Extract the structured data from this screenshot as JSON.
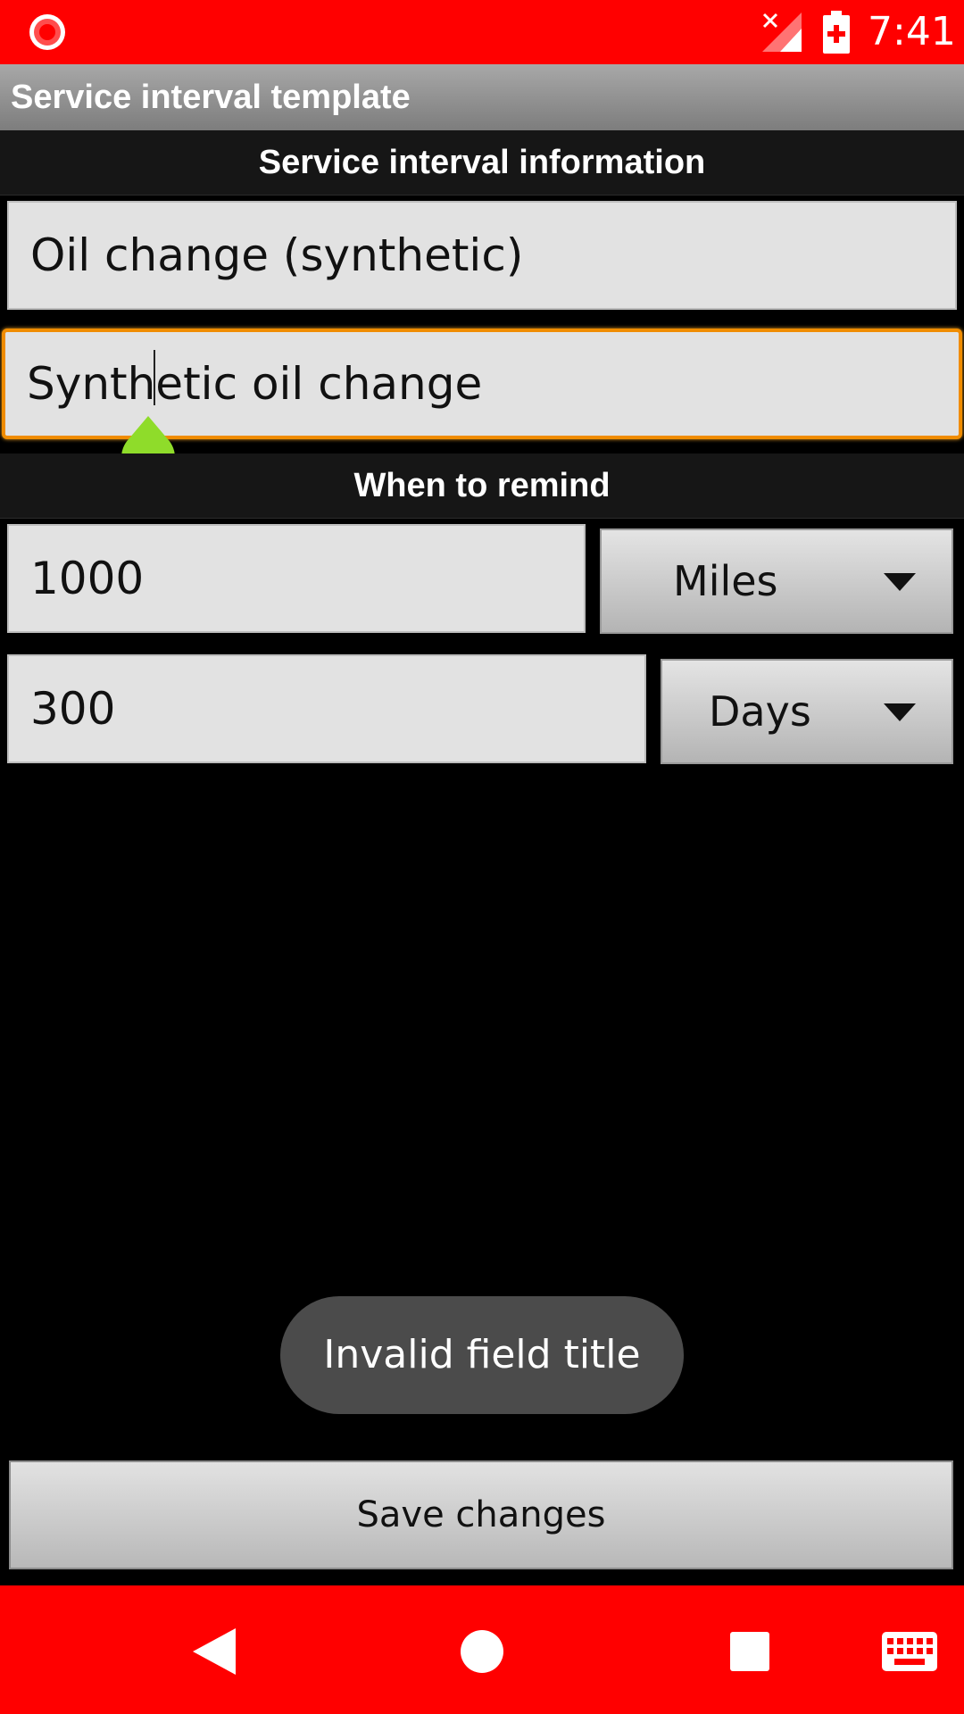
{
  "status_bar": {
    "time": "7:41",
    "icons": [
      "screen-record-icon",
      "no-signal-icon",
      "battery-charging-icon"
    ],
    "background_color": "#ff0000"
  },
  "title_bar": {
    "title": "Service interval template"
  },
  "sections": {
    "info_header": "Service interval information",
    "remind_header": "When to remind"
  },
  "fields": {
    "name_value": "Oil change (synthetic)",
    "title_value": "Synthetic oil change",
    "distance_value": "1000",
    "time_value": "300"
  },
  "spinners": {
    "distance_unit": "Miles",
    "time_unit": "Days"
  },
  "toast": {
    "message": "Invalid field title"
  },
  "actions": {
    "save_label": "Save changes"
  },
  "nav_bar": {
    "buttons": [
      "back-icon",
      "home-icon",
      "recents-icon",
      "keyboard-icon"
    ],
    "background_color": "#ff0000"
  },
  "colors": {
    "focus_border": "#f08c00",
    "cursor_handle": "#8fdc2a"
  }
}
